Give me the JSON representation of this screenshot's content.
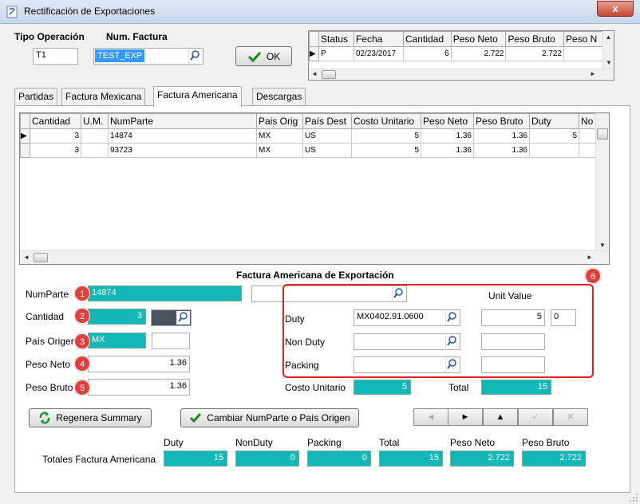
{
  "window": {
    "title": "Rectificación de Exportaciones",
    "close": "x"
  },
  "header": {
    "tipo_label": "Tipo Operación",
    "tipo_value": "T1",
    "factura_label": "Num. Factura",
    "factura_value": "TEST_EXP",
    "ok_label": "OK"
  },
  "summary_grid": {
    "columns": [
      "Status",
      "Fecha",
      "Cantidad",
      "Peso Neto",
      "Peso Bruto",
      "Peso N"
    ],
    "rows": [
      {
        "status": "P",
        "fecha": "02/23/2017",
        "cantidad": "6",
        "peso_neto": "2.722",
        "peso_bruto": "2.722",
        "peso_n": ""
      }
    ]
  },
  "tabs": [
    {
      "label": "Partidas"
    },
    {
      "label": "Factura Mexicana"
    },
    {
      "label": "Factura Americana"
    },
    {
      "label": "Descargas"
    }
  ],
  "items_grid": {
    "columns": [
      "Cantidad",
      "U.M.",
      "NumParte",
      "Pais Orig",
      "País Dest",
      "Costo Unitario",
      "Peso Neto",
      "Peso Bruto",
      "Duty",
      "No"
    ],
    "rows": [
      {
        "cantidad": "3",
        "um": "",
        "numparte": "14874",
        "pais_orig": "MX",
        "pais_dest": "US",
        "costo": "5",
        "peso_neto": "1.36",
        "peso_bruto": "1.36",
        "duty": "5",
        "no": ""
      },
      {
        "cantidad": "3",
        "um": "",
        "numparte": "93723",
        "pais_orig": "MX",
        "pais_dest": "US",
        "costo": "5",
        "peso_neto": "1.36",
        "peso_bruto": "1.36",
        "duty": "",
        "no": ""
      }
    ]
  },
  "detail": {
    "section_title": "Factura Americana de Exportación",
    "numparte_label": "NumParte",
    "numparte_value": "14874",
    "cantidad_label": "Cantidad",
    "cantidad_value": "3",
    "pais_label": "País Origen",
    "pais_value": "MX",
    "peso_neto_label": "Peso Neto",
    "peso_neto_value": "1.36",
    "peso_bruto_label": "Peso Bruto",
    "peso_bruto_value": "1.36",
    "unit_value_label": "Unit Value",
    "duty_label": "Duty",
    "duty_code": "MX0402.91.0600",
    "duty_value": "5",
    "duty_extra": "0",
    "nonduty_label": "Non Duty",
    "packing_label": "Packing",
    "costo_label": "Costo Unitario",
    "costo_value": "5",
    "total_label": "Total",
    "total_value": "15"
  },
  "badges": [
    "1",
    "2",
    "3",
    "4",
    "5",
    "6"
  ],
  "buttons": {
    "regenera": "Regenera Summary",
    "cambiar": "Cambiar NumParte o País Origen"
  },
  "totals": {
    "row_label": "Totales Factura Americana",
    "duty_label": "Duty",
    "duty_value": "15",
    "nonduty_label": "NonDuty",
    "nonduty_value": "0",
    "packing_label": "Packing",
    "packing_value": "0",
    "total_label": "Total",
    "total_value": "15",
    "peso_neto_label": "Peso Neto",
    "peso_neto_value": "2.722",
    "peso_bruto_label": "Peso Bruto",
    "peso_bruto_value": "2.722"
  },
  "colors": {
    "teal": "#12b8b8",
    "highlight": "#e62020",
    "selection": "#3399ff"
  }
}
